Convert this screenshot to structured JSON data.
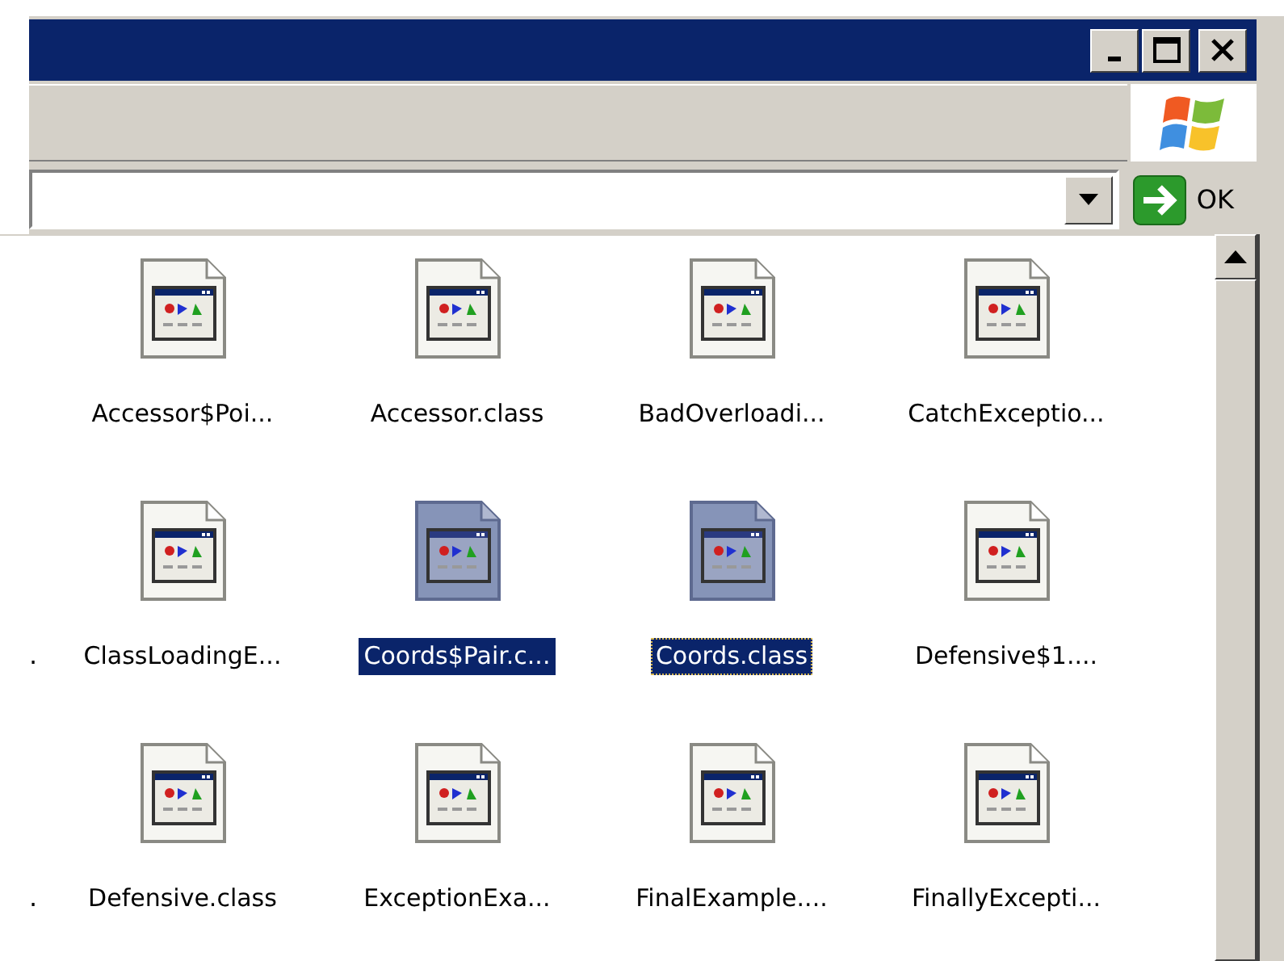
{
  "address_bar": {
    "go_button": "OK"
  },
  "file_rows": [
    {
      "leading_fragment": null,
      "items": [
        {
          "label": "Accessor$Poi...",
          "selected": false,
          "focused": false
        },
        {
          "label": "Accessor.class",
          "selected": false,
          "focused": false
        },
        {
          "label": "BadOverloadi...",
          "selected": false,
          "focused": false
        },
        {
          "label": "CatchExceptio...",
          "selected": false,
          "focused": false
        }
      ]
    },
    {
      "leading_fragment": ".",
      "items": [
        {
          "label": "ClassLoadingE...",
          "selected": false,
          "focused": false
        },
        {
          "label": "Coords$Pair.c...",
          "selected": true,
          "focused": false
        },
        {
          "label": "Coords.class",
          "selected": true,
          "focused": true
        },
        {
          "label": "Defensive$1....",
          "selected": false,
          "focused": false
        }
      ]
    },
    {
      "leading_fragment": ".",
      "items": [
        {
          "label": "Defensive.class",
          "selected": false,
          "focused": false
        },
        {
          "label": "ExceptionExa...",
          "selected": false,
          "focused": false
        },
        {
          "label": "FinalExample....",
          "selected": false,
          "focused": false
        },
        {
          "label": "FinallyExcepti...",
          "selected": false,
          "focused": false
        }
      ]
    }
  ]
}
